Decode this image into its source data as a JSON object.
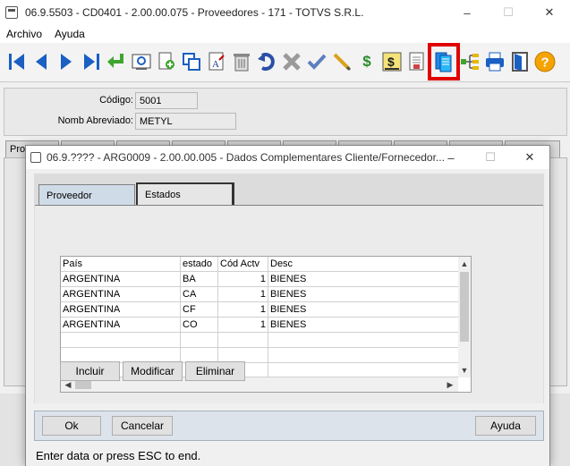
{
  "main_window": {
    "title": "06.9.5503 - CD0401 - 2.00.00.075 - Proveedores - 171 - TOTVS S.R.L.",
    "minimize": "–",
    "maximize": "☐",
    "close": "✕"
  },
  "menu": {
    "items": [
      "Archivo",
      "Ayuda"
    ]
  },
  "toolbar": {
    "icons": [
      "first-record",
      "previous-record",
      "next-record",
      "last-record",
      "goto",
      "search",
      "add",
      "copy",
      "edit-text",
      "delete",
      "undo",
      "cancel",
      "confirm",
      "pencil",
      "currency",
      "currency-doc",
      "report-doc",
      "complement-data",
      "tree",
      "print",
      "exit",
      "help"
    ],
    "highlighted": "complement-data",
    "highlight_color": "#e00000",
    "currency_glyph": "$",
    "help_glyph": "?"
  },
  "header_form": {
    "codigo_label": "Código:",
    "codigo_value": "5001",
    "nomb_label": "Nomb Abreviado:",
    "nomb_value": "METYL"
  },
  "background_tab": {
    "label": "Pro"
  },
  "dialog": {
    "title": "06.9.???? - ARG0009 - 2.00.00.005 - Dados Complementares Cliente/Fornecedor...",
    "minimize": "–",
    "maximize": "☐",
    "close": "✕",
    "tabs": [
      {
        "label": "Proveedor",
        "active": false
      },
      {
        "label": "Estados",
        "active": true
      }
    ],
    "grid": {
      "columns": [
        "País",
        "estado",
        "Cód Actv",
        "Desc"
      ],
      "rows": [
        [
          "ARGENTINA",
          "BA",
          "1",
          "BIENES"
        ],
        [
          "ARGENTINA",
          "CA",
          "1",
          "BIENES"
        ],
        [
          "ARGENTINA",
          "CF",
          "1",
          "BIENES"
        ],
        [
          "ARGENTINA",
          "CO",
          "1",
          "BIENES"
        ]
      ]
    },
    "buttons": {
      "incluir": "Incluir",
      "modificar": "Modificar",
      "eliminar": "Eliminar"
    },
    "footer": {
      "ok": "Ok",
      "cancelar": "Cancelar",
      "ayuda": "Ayuda"
    },
    "status": "Enter data or press ESC to end."
  }
}
